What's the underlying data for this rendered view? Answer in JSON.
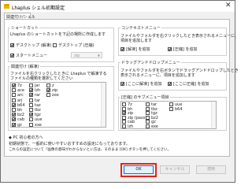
{
  "window": {
    "title": "Lhaplus シェル初期設定",
    "close_glyph": "✕"
  },
  "tabs": [
    {
      "label": "関連付け/シェル"
    }
  ],
  "shortcut": {
    "title": "ショートカット",
    "description": "Lhaplus のショートカットを下記の場所に作成します",
    "items": [
      {
        "label": "デスクトップ (解凍)",
        "checked": true
      },
      {
        "label": "デスクトップ (圧縮)",
        "checked": false
      },
      {
        "label": "スタートメニュー",
        "checked": true
      }
    ],
    "dropdown_value": "zip"
  },
  "association": {
    "title": "関連付け (解凍)",
    "description": "ファイルを右クリックしたときに Lhaplus で解凍するファイルの種類を選択してください",
    "items": [
      {
        "label": "7z",
        "checked": true
      },
      {
        "label": "ace",
        "checked": false
      },
      {
        "label": "arc",
        "checked": false
      },
      {
        "label": "arj",
        "checked": false
      },
      {
        "label": "b64",
        "checked": true
      },
      {
        "label": "bh",
        "checked": false
      },
      {
        "label": "bz2",
        "checked": true
      },
      {
        "label": "cab",
        "checked": true
      },
      {
        "label": "gz",
        "checked": true
      },
      {
        "label": "jar",
        "checked": false
      },
      {
        "label": "lzh",
        "checked": true
      },
      {
        "label": "rar",
        "checked": true
      },
      {
        "label": "tar",
        "checked": false
      },
      {
        "label": "taz",
        "checked": false
      },
      {
        "label": "tbz",
        "checked": false
      },
      {
        "label": "tgz",
        "checked": true
      },
      {
        "label": "uue",
        "checked": false
      },
      {
        "label": "xxe",
        "checked": false
      },
      {
        "label": "z",
        "checked": false
      },
      {
        "label": "zip",
        "checked": true
      },
      {
        "label": "zoo",
        "checked": false
      }
    ]
  },
  "context_menu": {
    "title": "コンテキストメニュー",
    "description": "ファイルやフォルダを右クリックしたとき表示されるメニューに、項目を追加します",
    "items": [
      {
        "label": "[解凍] を追加",
        "checked": true
      },
      {
        "label": "[圧縮] を追加",
        "checked": true
      }
    ]
  },
  "drag_drop": {
    "title": "ドラッグアンドドロップメニュー",
    "description": "ファイルやフォルダを右ボタンでドラッグアンドドロップしたとき表示されるメニューに、項目を追加します",
    "items": [
      {
        "label": "[ここに解凍] を追加",
        "checked": true
      },
      {
        "label": "[ここに圧縮] を追加",
        "checked": true
      }
    ]
  },
  "compress_submenu": {
    "title": "[圧縮] のサブメニュー項目",
    "items": [
      {
        "label": "7z",
        "checked": false
      },
      {
        "label": "bh",
        "checked": false
      },
      {
        "label": "zip",
        "checked": true
      },
      {
        "label": "zip (pass)",
        "checked": false
      },
      {
        "label": "cab",
        "checked": false
      },
      {
        "label": "lzh",
        "checked": false
      },
      {
        "label": "tar",
        "checked": false
      },
      {
        "label": "tbz",
        "checked": false
      },
      {
        "label": "tgz",
        "checked": false
      },
      {
        "label": "bz2",
        "checked": false
      },
      {
        "label": "gz",
        "checked": false
      },
      {
        "label": "exe",
        "checked": false
      },
      {
        "label": "uue",
        "checked": false
      },
      {
        "label": "b64",
        "checked": false
      }
    ]
  },
  "notes": {
    "heading": "◆ PC 初心者の方へ",
    "line1": "初期状態で、一般的に使いやすいおすすめの設定になっております。",
    "line2": "これらの設定について「画像の意味がわからないとい方は、そのまま [OK] ボタンを押してください。"
  },
  "buttons": {
    "ok": "OK",
    "cancel": "キャンセル",
    "apply": "適用"
  }
}
